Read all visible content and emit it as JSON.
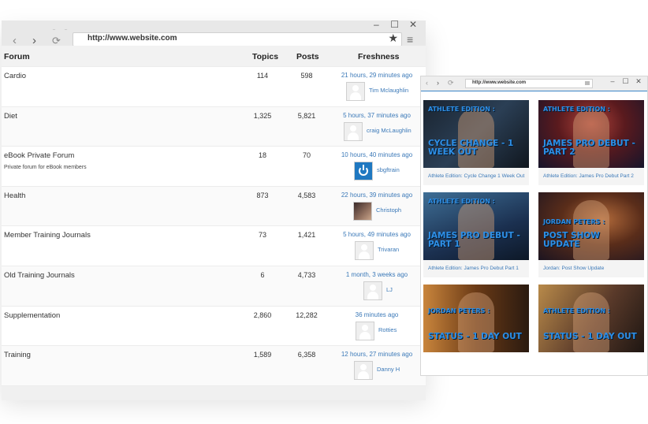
{
  "browser_main": {
    "url": "http://www.website.com",
    "controls": {
      "back": "‹",
      "forward": "›",
      "reload": "⟳",
      "star": "★",
      "menu": "≡",
      "minimize": "–",
      "maximize": "☐",
      "close": "✕"
    }
  },
  "forum_table": {
    "headers": {
      "forum": "Forum",
      "topics": "Topics",
      "posts": "Posts",
      "freshness": "Freshness"
    },
    "rows": [
      {
        "name": "Cardio",
        "description": "",
        "topics": "114",
        "posts": "598",
        "freshness": "21 hours, 29 minutes ago",
        "user": "Tim Mclaughlin",
        "avatar": "default-avatar-icon"
      },
      {
        "name": "Diet",
        "description": "",
        "topics": "1,325",
        "posts": "5,821",
        "freshness": "5 hours, 37 minutes ago",
        "user": "craig McLaughlin",
        "avatar": "default-avatar-icon"
      },
      {
        "name": "eBook Private Forum",
        "description": "Private forum for eBook members",
        "topics": "18",
        "posts": "70",
        "freshness": "10 hours, 40 minutes ago",
        "user": "sbgftrain",
        "avatar": "power-avatar-icon"
      },
      {
        "name": "Health",
        "description": "",
        "topics": "873",
        "posts": "4,583",
        "freshness": "22 hours, 39 minutes ago",
        "user": "Christoph",
        "avatar": "photo-avatar-icon"
      },
      {
        "name": "Member Training Journals",
        "description": "",
        "topics": "73",
        "posts": "1,421",
        "freshness": "5 hours, 49 minutes ago",
        "user": "Trivaran",
        "avatar": "default-avatar-icon"
      },
      {
        "name": "Old Training Journals",
        "description": "",
        "topics": "6",
        "posts": "4,733",
        "freshness": "1 month, 3 weeks ago",
        "user": "LJ",
        "avatar": "default-avatar-icon"
      },
      {
        "name": "Supplementation",
        "description": "",
        "topics": "2,860",
        "posts": "12,282",
        "freshness": "36 minutes ago",
        "user": "Rotties",
        "avatar": "default-avatar-icon"
      },
      {
        "name": "Training",
        "description": "",
        "topics": "1,589",
        "posts": "6,358",
        "freshness": "12 hours, 27 minutes ago",
        "user": "Danny H",
        "avatar": "default-avatar-icon"
      }
    ]
  },
  "browser_videos": {
    "url": "http://www.website.com",
    "videos": [
      {
        "thumb_top": "ATHLETE EDITION :",
        "thumb_main": "CYCLE CHANGE - 1 WEEK OUT",
        "caption": "Athlete Edition: Cycle Change 1 Week Out"
      },
      {
        "thumb_top": "ATHLETE EDITION :",
        "thumb_main": "JAMES PRO DEBUT - PART 2",
        "caption": "Athlete Edition: James Pro Debut Part 2"
      },
      {
        "thumb_top": "ATHLETE EDITION :",
        "thumb_main": "JAMES PRO DEBUT - PART 1",
        "caption": "Athlete Edition: James Pro Debut Part 1"
      },
      {
        "thumb_top": "JORDAN PETERS :",
        "thumb_main": "POST SHOW UPDATE",
        "caption": "Jordan: Post Show Update"
      },
      {
        "thumb_top": "JORDAN PETERS :",
        "thumb_main": "STATUS - 1 DAY OUT",
        "caption": ""
      },
      {
        "thumb_top": "ATHLETE EDITION :",
        "thumb_main": "STATUS - 1 DAY OUT",
        "caption": ""
      }
    ]
  },
  "colors": {
    "link": "#3b79b8",
    "thumb_text": "#2e8fe6",
    "accent_line": "#3a86c8"
  }
}
